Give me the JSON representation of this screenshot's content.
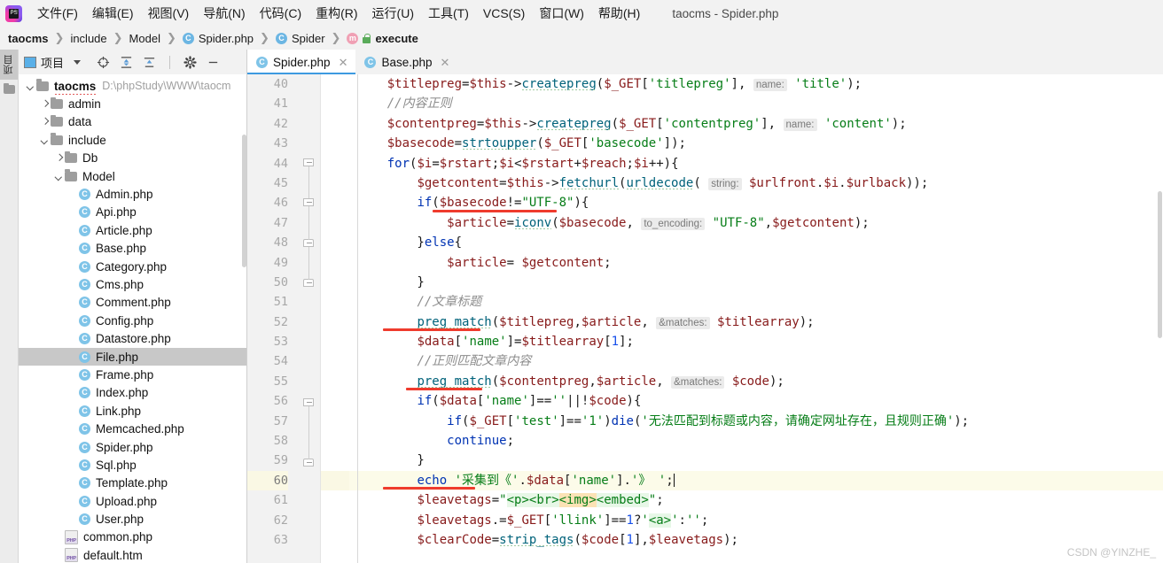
{
  "window": {
    "title": "taocms - Spider.php",
    "app_icon": "phpstorm-logo-icon"
  },
  "menu": {
    "items": [
      {
        "label": "文件(F)"
      },
      {
        "label": "编辑(E)"
      },
      {
        "label": "视图(V)"
      },
      {
        "label": "导航(N)"
      },
      {
        "label": "代码(C)"
      },
      {
        "label": "重构(R)"
      },
      {
        "label": "运行(U)"
      },
      {
        "label": "工具(T)"
      },
      {
        "label": "VCS(S)"
      },
      {
        "label": "窗口(W)"
      },
      {
        "label": "帮助(H)"
      }
    ]
  },
  "breadcrumb": {
    "items": [
      {
        "label": "taocms",
        "icon": "none",
        "bold": true
      },
      {
        "label": "include",
        "icon": "none",
        "bold": false
      },
      {
        "label": "Model",
        "icon": "none",
        "bold": false
      },
      {
        "label": "Spider.php",
        "icon": "class-badge",
        "bold": false
      },
      {
        "label": "Spider",
        "icon": "class-badge",
        "bold": false
      },
      {
        "label": "execute",
        "icon": "method-badge",
        "bold": true
      }
    ],
    "separator": "❯"
  },
  "project_panel": {
    "title": "项目",
    "toolbar_icons": [
      "locate-target-icon",
      "expand-all-icon",
      "collapse-all-icon",
      "settings-gear-icon",
      "hide-panel-icon"
    ],
    "strip_label": "项目",
    "tree": [
      {
        "depth": 0,
        "arrow": "down",
        "icon": "folder-icon",
        "label": "taocms",
        "bold": true,
        "path": "D:\\phpStudy\\WWW\\taocm",
        "selected": false
      },
      {
        "depth": 1,
        "arrow": "right",
        "icon": "folder-icon",
        "label": "admin",
        "bold": false,
        "path": "",
        "selected": false
      },
      {
        "depth": 1,
        "arrow": "right",
        "icon": "folder-icon",
        "label": "data",
        "bold": false,
        "path": "",
        "selected": false
      },
      {
        "depth": 1,
        "arrow": "down",
        "icon": "folder-icon",
        "label": "include",
        "bold": false,
        "path": "",
        "selected": false
      },
      {
        "depth": 2,
        "arrow": "right",
        "icon": "folder-icon",
        "label": "Db",
        "bold": false,
        "path": "",
        "selected": false
      },
      {
        "depth": 2,
        "arrow": "down",
        "icon": "folder-icon",
        "label": "Model",
        "bold": false,
        "path": "",
        "selected": false
      },
      {
        "depth": 3,
        "arrow": "none",
        "icon": "php-class-icon",
        "label": "Admin.php",
        "bold": false,
        "path": "",
        "selected": false
      },
      {
        "depth": 3,
        "arrow": "none",
        "icon": "php-class-icon",
        "label": "Api.php",
        "bold": false,
        "path": "",
        "selected": false
      },
      {
        "depth": 3,
        "arrow": "none",
        "icon": "php-class-icon",
        "label": "Article.php",
        "bold": false,
        "path": "",
        "selected": false
      },
      {
        "depth": 3,
        "arrow": "none",
        "icon": "php-class-icon",
        "label": "Base.php",
        "bold": false,
        "path": "",
        "selected": false
      },
      {
        "depth": 3,
        "arrow": "none",
        "icon": "php-class-icon",
        "label": "Category.php",
        "bold": false,
        "path": "",
        "selected": false
      },
      {
        "depth": 3,
        "arrow": "none",
        "icon": "php-class-icon",
        "label": "Cms.php",
        "bold": false,
        "path": "",
        "selected": false
      },
      {
        "depth": 3,
        "arrow": "none",
        "icon": "php-class-icon",
        "label": "Comment.php",
        "bold": false,
        "path": "",
        "selected": false
      },
      {
        "depth": 3,
        "arrow": "none",
        "icon": "php-class-icon",
        "label": "Config.php",
        "bold": false,
        "path": "",
        "selected": false
      },
      {
        "depth": 3,
        "arrow": "none",
        "icon": "php-class-icon",
        "label": "Datastore.php",
        "bold": false,
        "path": "",
        "selected": false
      },
      {
        "depth": 3,
        "arrow": "none",
        "icon": "php-class-icon",
        "label": "File.php",
        "bold": false,
        "path": "",
        "selected": true
      },
      {
        "depth": 3,
        "arrow": "none",
        "icon": "php-class-icon",
        "label": "Frame.php",
        "bold": false,
        "path": "",
        "selected": false
      },
      {
        "depth": 3,
        "arrow": "none",
        "icon": "php-class-icon",
        "label": "Index.php",
        "bold": false,
        "path": "",
        "selected": false
      },
      {
        "depth": 3,
        "arrow": "none",
        "icon": "php-class-icon",
        "label": "Link.php",
        "bold": false,
        "path": "",
        "selected": false
      },
      {
        "depth": 3,
        "arrow": "none",
        "icon": "php-class-icon",
        "label": "Memcached.php",
        "bold": false,
        "path": "",
        "selected": false
      },
      {
        "depth": 3,
        "arrow": "none",
        "icon": "php-class-icon",
        "label": "Spider.php",
        "bold": false,
        "path": "",
        "selected": false
      },
      {
        "depth": 3,
        "arrow": "none",
        "icon": "php-class-icon",
        "label": "Sql.php",
        "bold": false,
        "path": "",
        "selected": false
      },
      {
        "depth": 3,
        "arrow": "none",
        "icon": "php-class-icon",
        "label": "Template.php",
        "bold": false,
        "path": "",
        "selected": false
      },
      {
        "depth": 3,
        "arrow": "none",
        "icon": "php-class-icon",
        "label": "Upload.php",
        "bold": false,
        "path": "",
        "selected": false
      },
      {
        "depth": 3,
        "arrow": "none",
        "icon": "php-class-icon",
        "label": "User.php",
        "bold": false,
        "path": "",
        "selected": false
      },
      {
        "depth": 2,
        "arrow": "none",
        "icon": "php-file-icon",
        "label": "common.php",
        "bold": false,
        "path": "",
        "selected": false
      },
      {
        "depth": 2,
        "arrow": "none",
        "icon": "php-file-icon",
        "label": "default.htm",
        "bold": false,
        "path": "",
        "selected": false
      }
    ]
  },
  "editor": {
    "tabs": [
      {
        "label": "Spider.php",
        "icon": "php-class-icon",
        "active": true,
        "close": "✕"
      },
      {
        "label": "Base.php",
        "icon": "php-class-icon",
        "active": false,
        "close": "✕"
      }
    ],
    "current_line": 60,
    "first_line": 40,
    "last_line": 63,
    "line_numbers": [
      40,
      41,
      42,
      43,
      44,
      45,
      46,
      47,
      48,
      49,
      50,
      51,
      52,
      53,
      54,
      55,
      56,
      57,
      58,
      59,
      60,
      61,
      62,
      63
    ],
    "lines": [
      {
        "n": 40,
        "text": "    $titlepreg=$this->createpreg($_GET['titlepreg'], name: 'title');"
      },
      {
        "n": 41,
        "text": "    //内容正则"
      },
      {
        "n": 42,
        "text": "    $contentpreg=$this->createpreg($_GET['contentpreg'], name: 'content');"
      },
      {
        "n": 43,
        "text": "    $basecode=strtoupper($_GET['basecode']);"
      },
      {
        "n": 44,
        "text": "    for($i=$rstart;$i<$rstart+$reach;$i++){"
      },
      {
        "n": 45,
        "text": "        $getcontent=$this->fetchurl(urldecode( string: $urlfront.$i.$urlback));"
      },
      {
        "n": 46,
        "text": "        if($basecode!=\"UTF-8\"){"
      },
      {
        "n": 47,
        "text": "            $article=iconv($basecode, to_encoding: \"UTF-8\",$getcontent);"
      },
      {
        "n": 48,
        "text": "        }else{"
      },
      {
        "n": 49,
        "text": "            $article= $getcontent;"
      },
      {
        "n": 50,
        "text": "        }"
      },
      {
        "n": 51,
        "text": "        //文章标题"
      },
      {
        "n": 52,
        "text": "        preg_match($titlepreg,$article, &matches: $titlearray);"
      },
      {
        "n": 53,
        "text": "        $data['name']=$titlearray[1];"
      },
      {
        "n": 54,
        "text": "        //正则匹配文章内容"
      },
      {
        "n": 55,
        "text": "        preg_match($contentpreg,$article, &matches: $code);"
      },
      {
        "n": 56,
        "text": "        if($data['name']==''||!$code){"
      },
      {
        "n": 57,
        "text": "            if($_GET['test']=='1')die('无法匹配到标题或内容，请确定网址存在，且规则正确');"
      },
      {
        "n": 58,
        "text": "            continue;"
      },
      {
        "n": 59,
        "text": "        }"
      },
      {
        "n": 60,
        "text": "        echo '采集到《'.$data['name'].'》 ';"
      },
      {
        "n": 61,
        "text": "        $leavetags=\"<p><br><img><embed>\";"
      },
      {
        "n": 62,
        "text": "        $leavetags.=$_GET['llink']==1?'<a>':'';"
      },
      {
        "n": 63,
        "text": "        $clearCode=strip_tags($code[1],$leavetags);"
      }
    ],
    "annotations": [
      {
        "type": "red-underline",
        "target": "$basecode!=\"UTF-8\"",
        "line": 46
      },
      {
        "type": "red-underline",
        "target": "preg_match",
        "line": 52
      },
      {
        "type": "red-underline",
        "target": "preg_match",
        "line": 55
      },
      {
        "type": "red-underline",
        "target": "echo '采集到",
        "line": 60
      }
    ]
  },
  "watermark": {
    "text": "CSDN @YINZHE_"
  },
  "colors": {
    "accent": "#3d9ae0",
    "annotation_red": "#ef3b2d",
    "keyword": "#0033b3",
    "variable": "#871a1a",
    "string": "#067d17",
    "function": "#00627a",
    "comment": "#8c8c8c",
    "number": "#1750eb",
    "current_line_bg": "#fcfbe9",
    "selection_bg": "#c8c8c8"
  }
}
